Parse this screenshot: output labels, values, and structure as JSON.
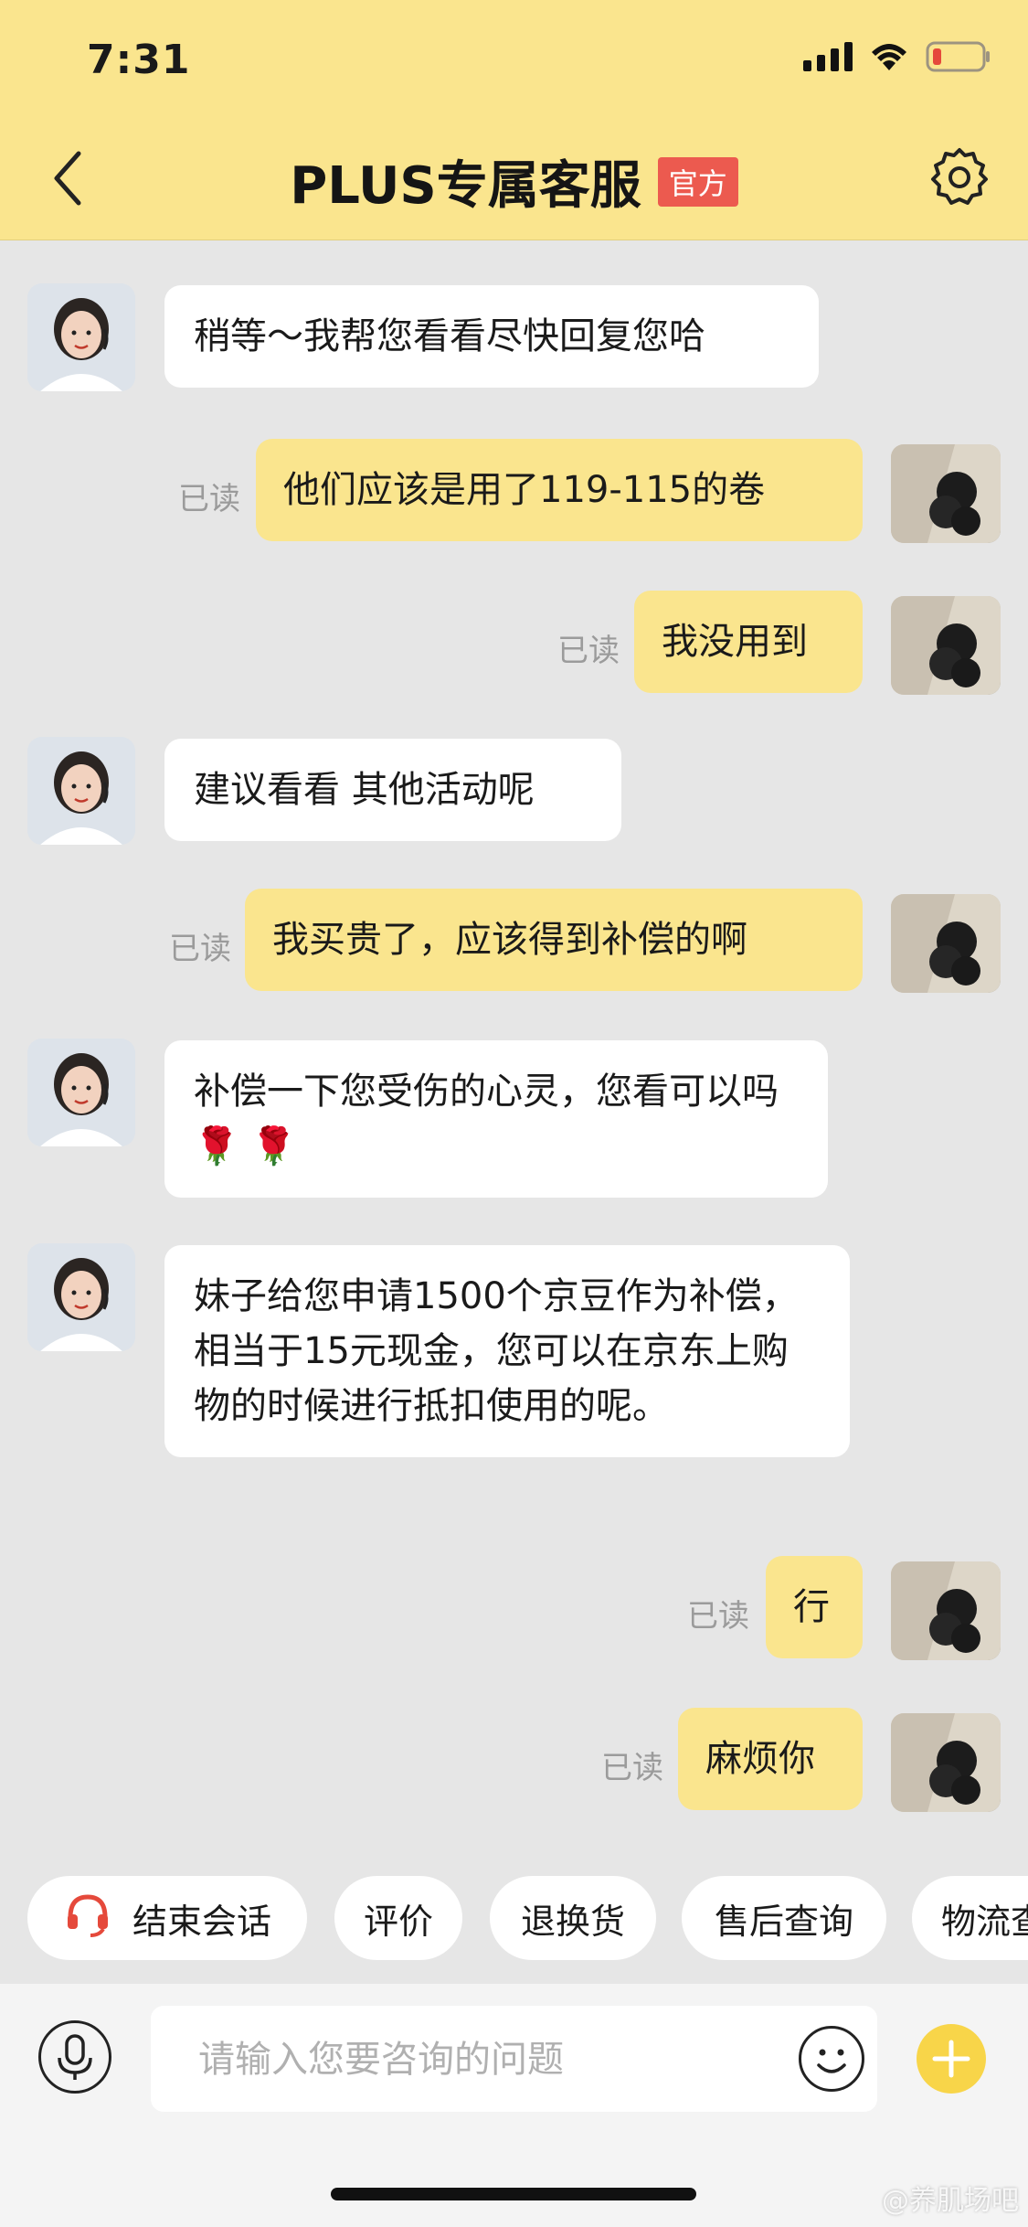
{
  "status_bar": {
    "time": "7:31"
  },
  "header": {
    "title": "PLUS专属客服",
    "badge": "官方"
  },
  "messages": [
    {
      "sender": "agent",
      "text": "稍等～我帮您看看尽快回复您哈"
    },
    {
      "sender": "user",
      "text": "他们应该是用了119-115的卷",
      "read": "已读"
    },
    {
      "sender": "user",
      "text": "我没用到",
      "read": "已读"
    },
    {
      "sender": "agent",
      "text": "建议看看 其他活动呢"
    },
    {
      "sender": "user",
      "text": "我买贵了，应该得到补偿的啊",
      "read": "已读"
    },
    {
      "sender": "agent",
      "text": "补偿一下您受伤的心灵，您看可以吗 🌹 🌹"
    },
    {
      "sender": "agent",
      "text": "妹子给您申请1500个京豆作为补偿，相当于15元现金，您可以在京东上购物的时候进行抵扣使用的呢。"
    },
    {
      "sender": "user",
      "text": "行",
      "read": "已读"
    },
    {
      "sender": "user",
      "text": "麻烦你",
      "read": "已读"
    }
  ],
  "quick_actions": [
    "结束会话",
    "评价",
    "退换货",
    "售后查询",
    "物流查询"
  ],
  "input": {
    "placeholder": "请输入您要咨询的问题"
  },
  "watermark": "@养肌场吧",
  "colors": {
    "header_bg": "#fae58e",
    "user_bubble": "#fae58e",
    "badge_bg": "#ec5a4f",
    "plus_button": "#f8d549",
    "headset_icon": "#e5493b"
  },
  "icons": [
    "back-icon",
    "settings-icon",
    "microphone-icon",
    "emoji-icon",
    "plus-icon",
    "headset-icon"
  ]
}
